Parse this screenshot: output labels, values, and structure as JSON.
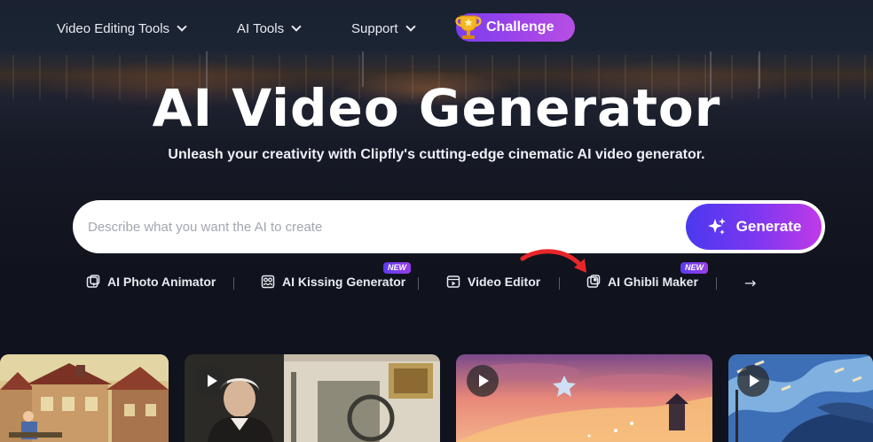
{
  "nav": {
    "items": [
      {
        "label": "Video Editing Tools"
      },
      {
        "label": "AI Tools"
      },
      {
        "label": "Support"
      }
    ],
    "challenge_label": "Challenge"
  },
  "hero": {
    "title": "AI Video Generator",
    "subtitle": "Unleash your creativity with Clipfly's cutting-edge cinematic AI video generator."
  },
  "search": {
    "placeholder": "Describe what you want the AI to create",
    "value": "",
    "button_label": "Generate"
  },
  "tools": {
    "items": [
      {
        "label": "AI Photo Animator",
        "icon": "photo-animator-icon",
        "badge": ""
      },
      {
        "label": "AI Kissing Generator",
        "icon": "kissing-icon",
        "badge": "NEW"
      },
      {
        "label": "Video Editor",
        "icon": "video-editor-icon",
        "badge": ""
      },
      {
        "label": "AI Ghibli Maker",
        "icon": "ghibli-icon",
        "badge": "NEW"
      }
    ],
    "more_icon": "arrow-right-icon"
  },
  "colors": {
    "accent_start": "#4a39ef",
    "accent_end": "#c03ae8",
    "annotation_arrow": "#e8262a",
    "background": "#10121d"
  },
  "gallery": {
    "cards": [
      {
        "thumb": "village-houses",
        "play": false
      },
      {
        "thumb": "historical-portrait",
        "play": true
      },
      {
        "thumb": "sunset-river",
        "play": true
      },
      {
        "thumb": "blue-waves-fish",
        "play": true
      }
    ]
  }
}
